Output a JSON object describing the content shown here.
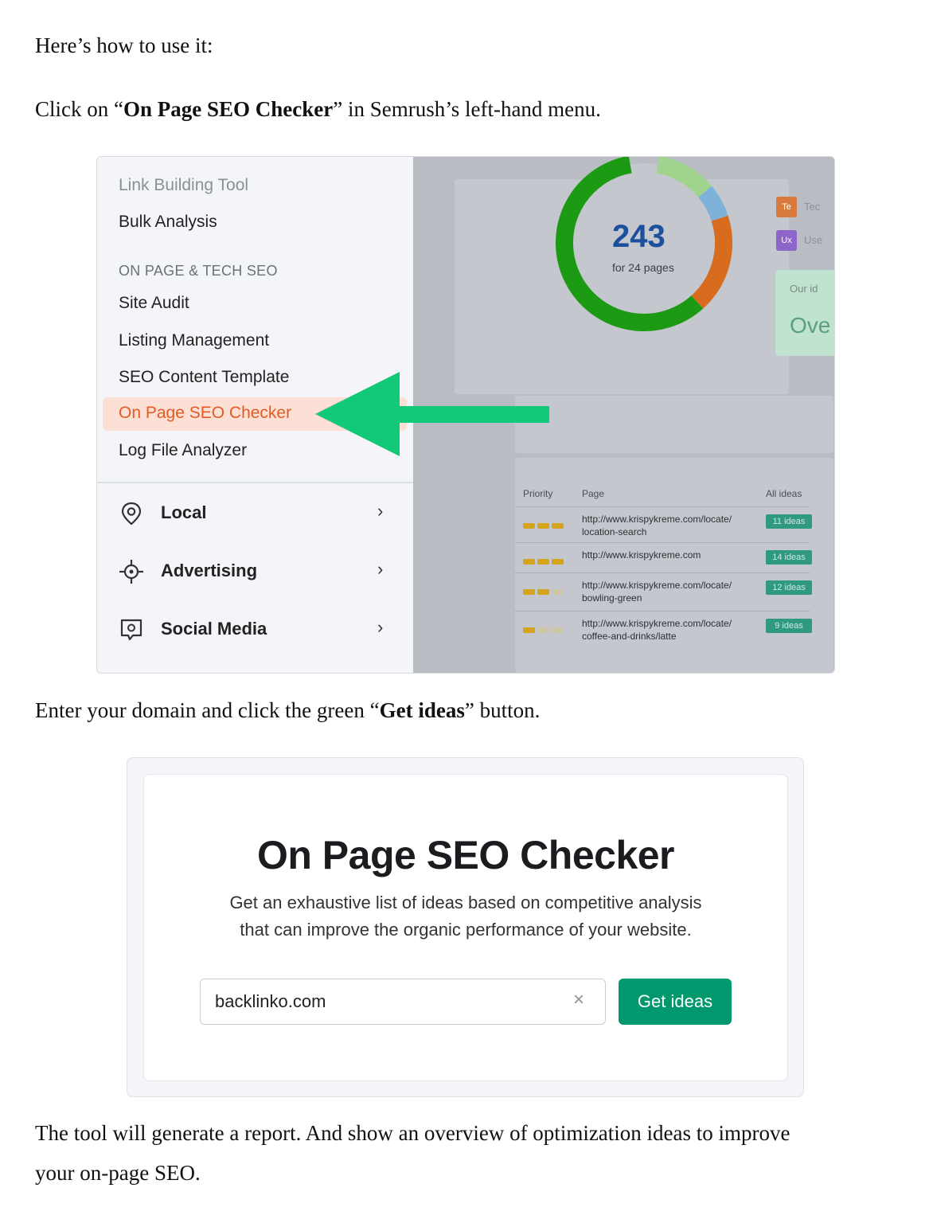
{
  "intro": "Here’s how to use it:",
  "step1": {
    "before": "Click on “",
    "bold": "On Page SEO Checker",
    "after": "” in Semrush’s left-hand menu."
  },
  "menu": {
    "items_top": [
      "Link Building Tool",
      "Bulk Analysis"
    ],
    "section_label": "ON PAGE & TECH SEO",
    "items": [
      "Site Audit",
      "Listing Management",
      "SEO Content Template"
    ],
    "active": "On Page SEO Checker",
    "items_after": [
      "Log File Analyzer"
    ],
    "categories": [
      {
        "label": "Local",
        "icon": "location-pin-icon"
      },
      {
        "label": "Advertising",
        "icon": "crosshair-icon"
      },
      {
        "label": "Social Media",
        "icon": "chat-bubble-icon"
      }
    ],
    "chevron": "›"
  },
  "dashboard": {
    "total": "243",
    "subtitle": "for 24 pages",
    "legend": [
      {
        "chip": "Te",
        "text": "Tec",
        "color": "#d87a3c"
      },
      {
        "chip": "Ux",
        "text": "Use",
        "color": "#8e65c9"
      }
    ],
    "ideas_label": "Our id",
    "ideas_value": "Ove",
    "table": {
      "headers": [
        "Priority",
        "Page",
        "All ideas"
      ],
      "rows": [
        {
          "bars": 3,
          "url1": "http://www.krispykreme.com/locate/",
          "url2": "location-search",
          "ideas": "11 ideas"
        },
        {
          "bars": 3,
          "url1": "http://www.krispykreme.com",
          "url2": "",
          "ideas": "14 ideas"
        },
        {
          "bars": 2,
          "url1": "http://www.krispykreme.com/locate/",
          "url2": "bowling-green",
          "ideas": "12 ideas"
        },
        {
          "bars": 1,
          "url1": "http://www.krispykreme.com/locate/",
          "url2": "coffee-and-drinks/latte",
          "ideas": "9 ideas"
        }
      ]
    },
    "donut_colors": {
      "green": "#1c9a14",
      "orange": "#d86c1e",
      "blue": "#7fb2d9",
      "lightgreen": "#9fd38e"
    }
  },
  "step2": {
    "before": "Enter your domain and click the green “",
    "bold": "Get ideas",
    "after": "” button."
  },
  "checker": {
    "title": "On Page SEO Checker",
    "desc_line1": "Get an exhaustive list of ideas based on competitive analysis",
    "desc_line2": "that can improve the organic performance of your website.",
    "input_value": "backlinko.com",
    "clear": "×",
    "button": "Get ideas"
  },
  "outro_line1": "The tool will generate a report. And show an overview of optimization ideas to improve",
  "outro_line2": "your on-page SEO."
}
